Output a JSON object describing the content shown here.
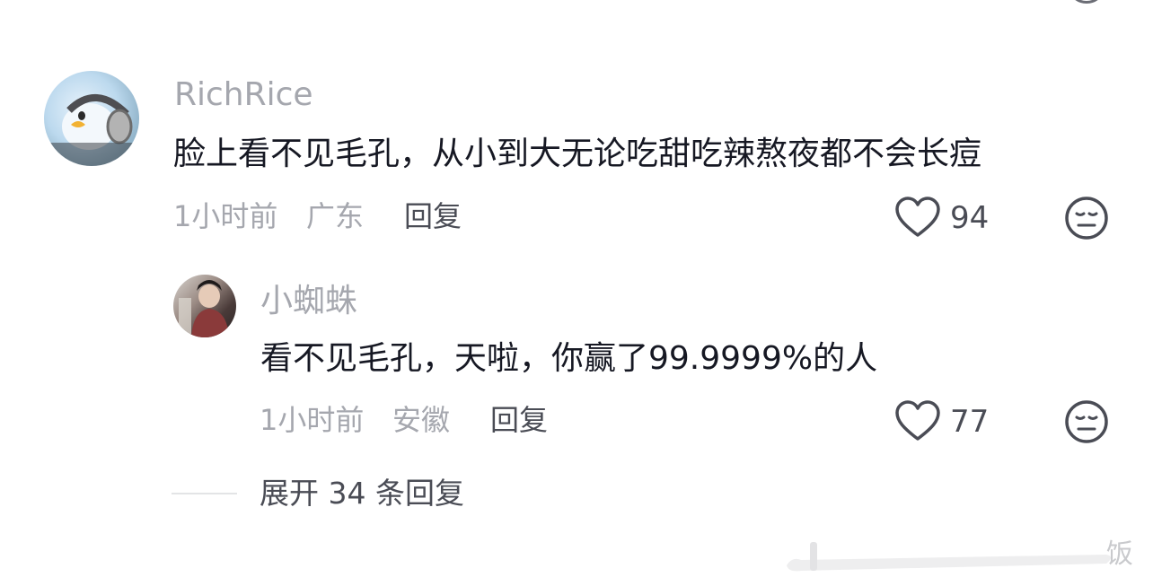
{
  "comment": {
    "username": "RichRice",
    "text": "脸上看不见毛孔，从小到大无论吃甜吃辣熬夜都不会长痘",
    "time": "1小时前",
    "location": "广东",
    "reply_label": "回复",
    "likes": "94",
    "avatar_icon": "duck-headphones-avatar"
  },
  "reply": {
    "username": "小蜘蛛",
    "text": "看不见毛孔，天啦，你赢了99.9999%的人",
    "time": "1小时前",
    "location": "安徽",
    "reply_label": "回复",
    "likes": "77",
    "avatar_icon": "person-photo-avatar"
  },
  "expand": {
    "label": "展开 34 条回复"
  },
  "watermark": {
    "text": "饭"
  },
  "colors": {
    "text_primary": "#161823",
    "text_secondary": "#a5a7ae",
    "text_action": "#4a4c55",
    "background": "#ffffff"
  }
}
